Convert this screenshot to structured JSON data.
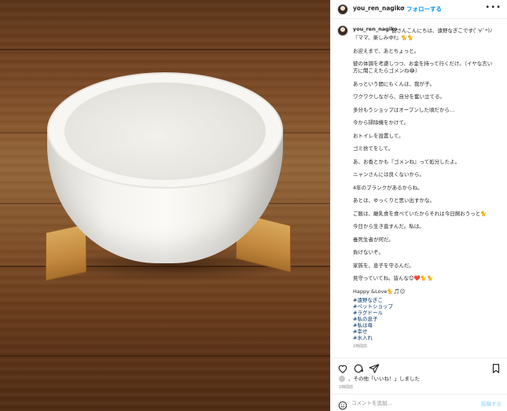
{
  "header": {
    "username": "you_ren_nagiko",
    "separator": "•",
    "follow_label": "フォローする",
    "more_icon": "more-horizontal-icon"
  },
  "caption": {
    "username": "you_ren_nagiko",
    "first_line": "皆さんこんにちは、遠野なぎこです(ﾟ∀ﾟ*)ﾉ",
    "lines": [
      "『ママ、楽しみ中‼︎』🐈🐈",
      "",
      "お迎えまで、あとちょっと。",
      "",
      "彼の体調を考慮しつつ、お金を持って行くだけ。（イヤな言い",
      "方に聞こえたらゴメンね😂）",
      "",
      "あっという間にもくんは、我が子。",
      "",
      "ワクワクしながら、自分を奮い立てる。",
      "",
      "多分もうショップはオープンした頃だから…",
      "",
      "今から掃除機をかけて。",
      "",
      "おトイレを設置して。",
      "",
      "ゴミ捨てをして。",
      "",
      "あ、お香とかも『ゴメンね』って処分したよ。",
      "",
      "ニャンさんには良くないから。",
      "",
      "4年のブランクがあるからね。",
      "",
      "あとは、ゆっくりと思い出すかな。",
      "",
      "ご飯は、離乳食を食べていたからそれは今日飼おうっと🐈",
      "",
      "今日から生き直すんだ。私は。",
      "",
      "養死生者が何だ。",
      "",
      "負けないぞ。",
      "",
      "家族を、息子を守るんだ。",
      "",
      "見守っていてね。皆んな😊❤️🐈🐈",
      "",
      "Happy &Love🐈🎵☺"
    ],
    "hashtags": [
      "#遠野なぎこ",
      "#ペットショップ",
      "#ラグドール",
      "#私の息子",
      "#私は母",
      "#幸せ",
      "#水入れ"
    ],
    "time": "1時間前"
  },
  "actions": {
    "like_icon": "heart-icon",
    "comment_icon": "comment-icon",
    "share_icon": "paper-plane-icon",
    "save_icon": "bookmark-icon"
  },
  "likes_text": "、その他「いいね！」しました",
  "post_date": "1時間前",
  "comment": {
    "emoji_icon": "smiley-icon",
    "placeholder": "コメントを追加...",
    "post_label": "投稿する"
  }
}
